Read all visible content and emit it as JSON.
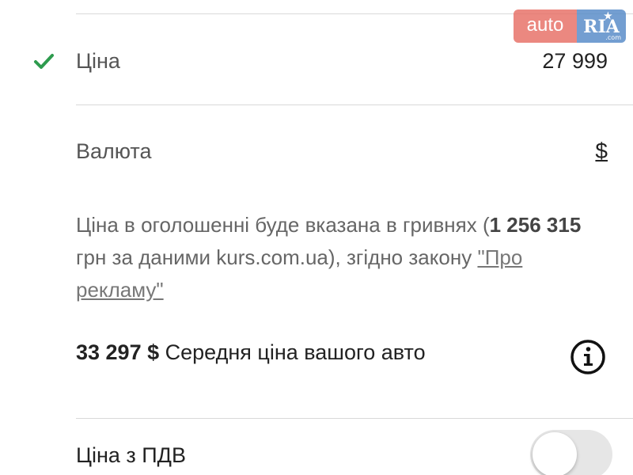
{
  "price": {
    "label": "Ціна",
    "value": "27 999",
    "checked": true
  },
  "currency": {
    "label": "Валюта",
    "value": "$"
  },
  "note": {
    "line_start": "Ціна в оголошенні буде вказана в гривнях (",
    "amount": "1 256 315",
    "line_middle": " грн за даними kurs.com.ua), згідно закону ",
    "law_link": "\"Про рекламу\""
  },
  "average": {
    "amount": "33 297 $",
    "text": " Середня ціна вашого авто"
  },
  "vat": {
    "label": "Ціна з ПДВ",
    "enabled": false
  },
  "watermark": {
    "left": "auto",
    "right": "RIA",
    "suffix": ".com"
  },
  "colors": {
    "check": "#2e9b4e",
    "watermark_auto": "#e8746a",
    "watermark_ria": "#5b8ec9"
  },
  "icons": {
    "check": "check-icon",
    "info": "info-icon",
    "watermark_star": "star-icon"
  }
}
